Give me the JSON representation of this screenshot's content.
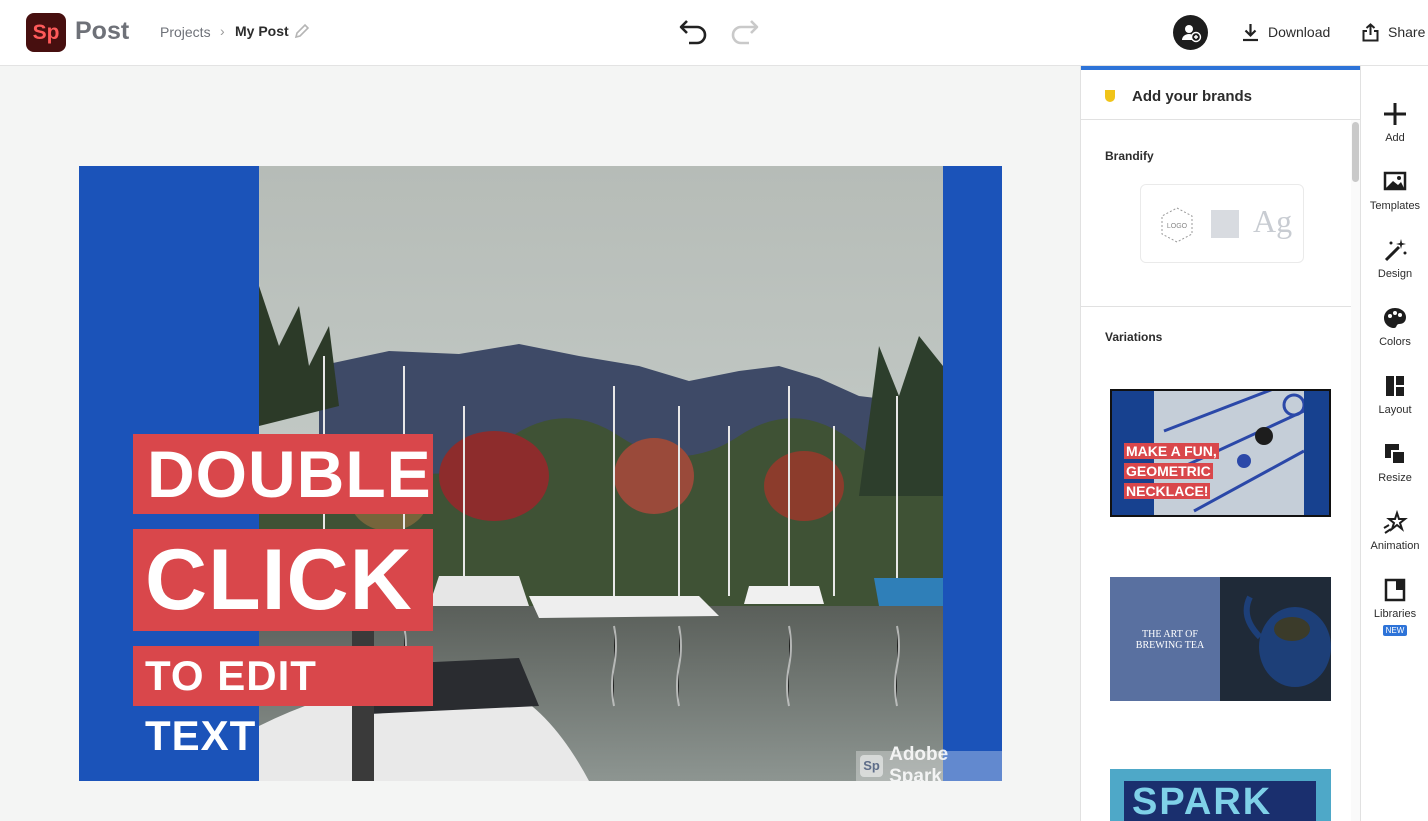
{
  "header": {
    "logo_text": "Sp",
    "app_name": "Post",
    "breadcrumb": {
      "projects": "Projects",
      "separator": "›",
      "current": "My Post"
    },
    "download_label": "Download",
    "share_label": "Share"
  },
  "canvas": {
    "headline_lines": [
      "DOUBLE",
      "CLICK",
      "TO EDIT TEXT"
    ],
    "watermark": {
      "badge": "Sp",
      "text": "Adobe Spark"
    },
    "colors": {
      "background": "#1b53b9",
      "text_box": "#d9474b"
    }
  },
  "panel": {
    "title": "Add your brands",
    "brandify_label": "Brandify",
    "brandify_logo_text": "LOGO",
    "brandify_font_sample": "Ag",
    "variations_label": "Variations",
    "variations": [
      {
        "text_lines": [
          "MAKE A FUN,",
          "GEOMETRIC",
          "NECKLACE!"
        ]
      },
      {
        "text_lines": [
          "THE ART OF",
          "BREWING TEA"
        ]
      },
      {
        "text_lines": [
          "SPARK"
        ]
      }
    ]
  },
  "rail": {
    "items": [
      {
        "label": "Add",
        "icon": "plus-icon"
      },
      {
        "label": "Templates",
        "icon": "templates-icon"
      },
      {
        "label": "Design",
        "icon": "magic-wand-icon"
      },
      {
        "label": "Colors",
        "icon": "palette-icon"
      },
      {
        "label": "Layout",
        "icon": "layout-icon"
      },
      {
        "label": "Resize",
        "icon": "resize-icon"
      },
      {
        "label": "Animation",
        "icon": "animation-icon"
      },
      {
        "label": "Libraries",
        "icon": "libraries-icon",
        "badge": "NEW"
      }
    ]
  }
}
